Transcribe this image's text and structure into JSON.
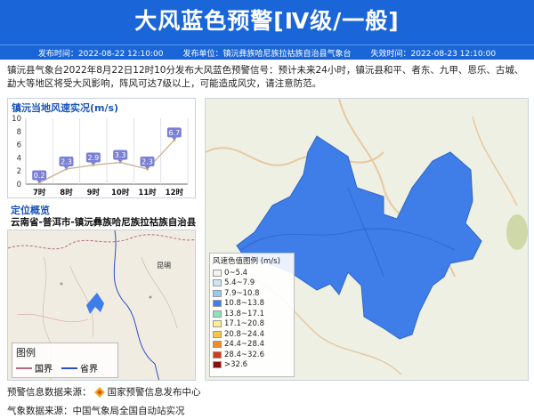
{
  "header": {
    "title": "大风蓝色预警[Ⅳ级/一般]",
    "publish_time": "发布时间：2022-08-22 12:10:00",
    "publisher": "发布单位：镇沅彝族哈尼族拉祜族自治县气象台",
    "expire_time": "失效时间：2022-08-23 12:10:00"
  },
  "description": "镇沅县气象台2022年8月22日12时10分发布大风蓝色预警信号：预计未来24小时，镇沅县和平、者东、九甲、恩乐、古城、勐大等地区将受大风影响，阵风可达7级以上，可能造成风灾，请注意防范。",
  "wind_panel": {
    "title": "镇沅当地风速实况(m/s)"
  },
  "chart_data": {
    "type": "line",
    "categories": [
      "7时",
      "8时",
      "9时",
      "10时",
      "11时",
      "12时"
    ],
    "values": [
      0.2,
      2.3,
      2.9,
      3.3,
      2.3,
      6.7
    ],
    "ylim": [
      0,
      10
    ],
    "yticks": [
      "0",
      "2",
      "4",
      "6",
      "8",
      "10"
    ],
    "title": "镇沅当地风速实况(m/s)",
    "grid": "vertical",
    "label_color": "#7a80d4",
    "line_color": "#c8b59a"
  },
  "location": {
    "title": "定位概览",
    "region": "云南省-普洱市-镇沅彝族哈尼族拉祜族自治县"
  },
  "small_map": {
    "city_label": "昆明",
    "legend_title": "图例",
    "legend_items": [
      {
        "label": "国界",
        "color": "#b06a84"
      },
      {
        "label": "省界",
        "color": "#2b4fc4"
      }
    ]
  },
  "big_map": {
    "region_color": "#3f7de8",
    "legend_title": "风速色值图例 (m/s)",
    "legend_items": [
      {
        "label": "0~5.4",
        "color": "#f2f2f2"
      },
      {
        "label": "5.4~7.9",
        "color": "#cfe3f7"
      },
      {
        "label": "7.9~10.8",
        "color": "#98c8f0"
      },
      {
        "label": "10.8~13.8",
        "color": "#3f7de8"
      },
      {
        "label": "13.8~17.1",
        "color": "#8fe3b7"
      },
      {
        "label": "17.1~20.8",
        "color": "#fbf08b"
      },
      {
        "label": "20.8~24.4",
        "color": "#f9c64a"
      },
      {
        "label": "24.4~28.4",
        "color": "#f08a2a"
      },
      {
        "label": "28.4~32.6",
        "color": "#d43a1c"
      },
      {
        "label": ">32.6",
        "color": "#8c0f0f"
      }
    ]
  },
  "footer": {
    "warning_source_label": "预警信息数据来源：",
    "warning_source": "国家预警信息发布中心",
    "weather_source": "气象数据来源：中国气象局全国自动站实况"
  }
}
